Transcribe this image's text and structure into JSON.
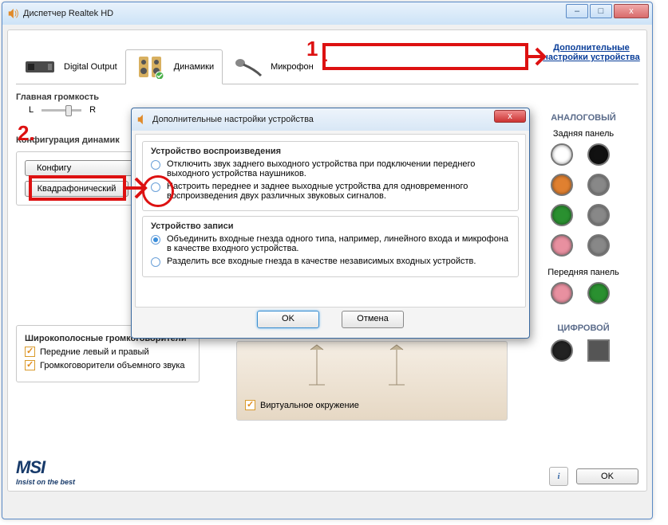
{
  "window": {
    "title": "Диспетчер Realtek HD",
    "min": "–",
    "max": "□",
    "close": "x"
  },
  "tabs": {
    "digital": "Digital Output",
    "speakers": "Динамики",
    "mic": "Микрофон"
  },
  "advanced_link": "Дополнительные настройки устройства",
  "main_volume": {
    "label": "Главная громкость",
    "left": "L",
    "right": "R"
  },
  "speaker_config": {
    "label": "Конфигурация динамик",
    "btn_config": "Конфигу",
    "btn_quad": "Квадрафонический"
  },
  "wideband": {
    "label": "Широкополосные громкоговорители",
    "front": "Передние левый и правый",
    "surround": "Громкоговорители объемного звука"
  },
  "virtual_env": "Виртуальное окружение",
  "side": {
    "analog": "АНАЛОГОВЫЙ",
    "back_panel": "Задняя панель",
    "front_panel": "Передняя панель",
    "digital": "ЦИФРОВОЙ"
  },
  "jack_colors": {
    "blue": "#1a5ac8",
    "black": "#111",
    "orange": "#e08030",
    "gray": "#888",
    "green": "#2a9030",
    "gray2": "#888",
    "pink": "#e890a0",
    "gray3": "#888",
    "fp_pink": "#e890a0",
    "fp_green": "#2a9030",
    "dig1": "#222"
  },
  "footer": {
    "brand": "MSI",
    "tagline": "Insist on the best",
    "info": "i",
    "ok": "OK"
  },
  "modal": {
    "title": "Дополнительные настройки устройства",
    "close": "x",
    "playback": {
      "legend": "Устройство воспроизведения",
      "opt1": "Отключить звук заднего выходного устройства при подключении переднего выходного устройства наушников.",
      "opt2": "Настроить переднее и заднее выходные устройства для одновременного воспроизведения двух различных звуковых сигналов."
    },
    "record": {
      "legend": "Устройство записи",
      "opt1": "Объединить входные гнезда одного типа, например, линейного входа и микрофона в качестве входного устройства.",
      "opt2": "Разделить все входные гнезда в качестве независимых входных устройств."
    },
    "ok": "OK",
    "cancel": "Отмена"
  },
  "annotations": {
    "n1": "1",
    "n2": "2.",
    "dash": "-"
  }
}
